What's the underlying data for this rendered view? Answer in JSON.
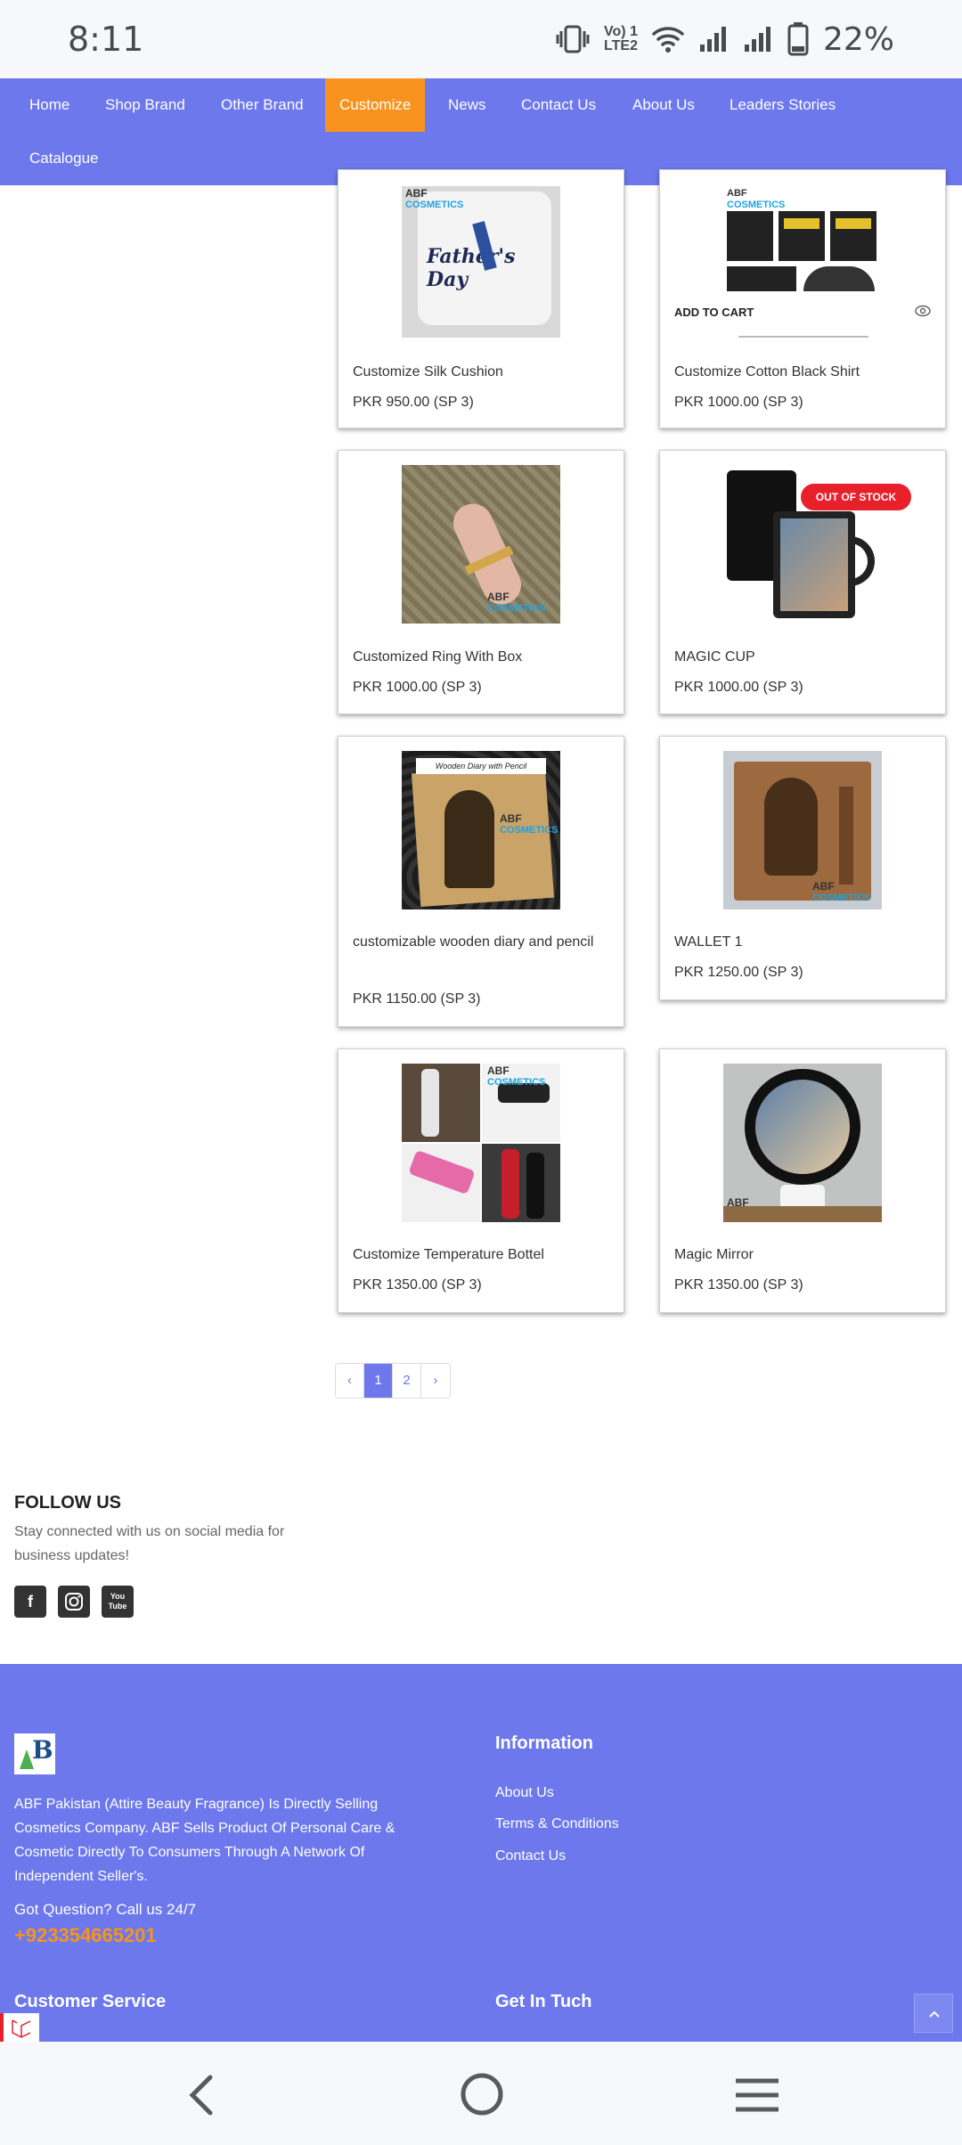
{
  "status_bar": {
    "time": "8:11",
    "network_label": "Vo) 1\nLTE2",
    "battery": "22%"
  },
  "nav": {
    "items": [
      {
        "label": "Home"
      },
      {
        "label": "Shop Brand"
      },
      {
        "label": "Other Brand"
      },
      {
        "label": "Customize",
        "active": true
      },
      {
        "label": "News"
      },
      {
        "label": "Contact Us"
      },
      {
        "label": "About Us"
      },
      {
        "label": "Leaders Stories"
      },
      {
        "label": "Catalogue"
      }
    ]
  },
  "products": [
    {
      "title": "Customize Silk Cushion",
      "price": "PKR 950.00 (SP 3)"
    },
    {
      "title": "Customize Cotton Black Shirt",
      "price": "PKR 1000.00 (SP 3)",
      "add_to_cart": "ADD TO CART"
    },
    {
      "title": "Customized Ring With Box",
      "price": "PKR 1000.00 (SP 3)"
    },
    {
      "title": "MAGIC CUP",
      "price": "PKR 1000.00 (SP 3)",
      "badge": "OUT OF STOCK"
    },
    {
      "title": "customizable wooden diary and pencil",
      "price": "PKR 1150.00 (SP 3)"
    },
    {
      "title": "WALLET 1",
      "price": "PKR 1250.00 (SP 3)"
    },
    {
      "title": "Customize Temperature Bottel",
      "price": "PKR 1350.00 (SP 3)"
    },
    {
      "title": "Magic Mirror",
      "price": "PKR 1350.00 (SP 3)"
    }
  ],
  "image_text": {
    "brand_line1": "ABF",
    "brand_line2": "COSMETICS",
    "cushion_text": "Father's Day",
    "diary_text": "Wooden Diary with Pencil"
  },
  "pagination": {
    "prev": "‹",
    "pages": [
      "1",
      "2"
    ],
    "next": "›",
    "current": "1"
  },
  "follow": {
    "title": "FOLLOW US",
    "text": "Stay connected with us on social media for business updates!",
    "icons": [
      "facebook-icon",
      "instagram-icon",
      "youtube-icon"
    ],
    "facebook_glyph": "f",
    "youtube_glyph": "You Tube"
  },
  "footer": {
    "about": "ABF Pakistan (Attire Beauty Fragrance) Is Directly Selling Cosmetics Company. ABF Sells Product Of Personal Care & Cosmetic Directly To Consumers Through A Network Of Independent Seller's.",
    "question": "Got Question? Call us 24/7",
    "phone": "+923354665201",
    "information_title": "Information",
    "information_links": [
      "About Us",
      "Terms & Conditions",
      "Contact Us"
    ],
    "customer_service_title": "Customer Service",
    "get_in_touch_title": "Get In Tuch",
    "logo_letter": "B"
  },
  "colors": {
    "primary": "#6c78ec",
    "accent": "#f7931e",
    "out_of_stock": "#e8202a"
  }
}
